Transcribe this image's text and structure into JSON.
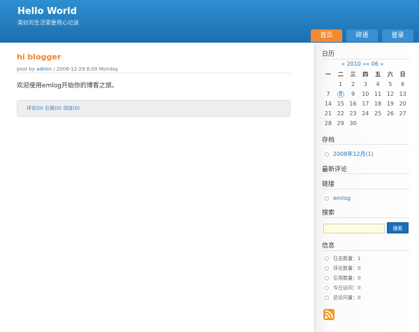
{
  "header": {
    "title": "Hello World",
    "subtitle": "美好的生活需要用心记录"
  },
  "nav": {
    "items": [
      {
        "label": "首页"
      },
      {
        "label": "碎语"
      },
      {
        "label": "登录"
      }
    ]
  },
  "post": {
    "title": "hi blogger",
    "meta": {
      "prefix": "post by ",
      "author": "admin",
      "date": " / 2008-12-29 8:00 Monday"
    },
    "body": "欢迎使用emlog开始你的博客之旅。",
    "links": "评论(0) 引用(0) 浏览(0)"
  },
  "sidebar": {
    "calendar": {
      "title": "日历",
      "nav": "« 2010 »« 06 »",
      "weekdays": [
        "一",
        "二",
        "三",
        "四",
        "五",
        "六",
        "日"
      ],
      "rows": [
        [
          "",
          "1",
          "2",
          "3",
          "4",
          "5",
          "6"
        ],
        [
          "7",
          "8",
          "9",
          "10",
          "11",
          "12",
          "13"
        ],
        [
          "14",
          "15",
          "16",
          "17",
          "18",
          "19",
          "20"
        ],
        [
          "21",
          "22",
          "23",
          "24",
          "25",
          "26",
          "27"
        ],
        [
          "28",
          "29",
          "30",
          "",
          "",
          "",
          ""
        ]
      ],
      "today": "8"
    },
    "archive": {
      "title": "存档",
      "items": [
        {
          "label": "2008年12月(1)"
        }
      ]
    },
    "latest_comments": {
      "title": "最新评论"
    },
    "links": {
      "title": "链接",
      "items": [
        {
          "label": "emlog"
        }
      ]
    },
    "search": {
      "title": "搜索",
      "button": "搜索"
    },
    "info": {
      "title": "信息",
      "items": [
        {
          "label": "日志数量：1"
        },
        {
          "label": "评论数量：0"
        },
        {
          "label": "引用数量：0"
        },
        {
          "label": "今日访问：0"
        },
        {
          "label": "总访问量：0"
        }
      ]
    }
  },
  "colors": {
    "header": "#1a6fb0",
    "accent": "#f28a32",
    "link": "#2a79bb"
  },
  "icons": {
    "rss": "rss-icon"
  }
}
